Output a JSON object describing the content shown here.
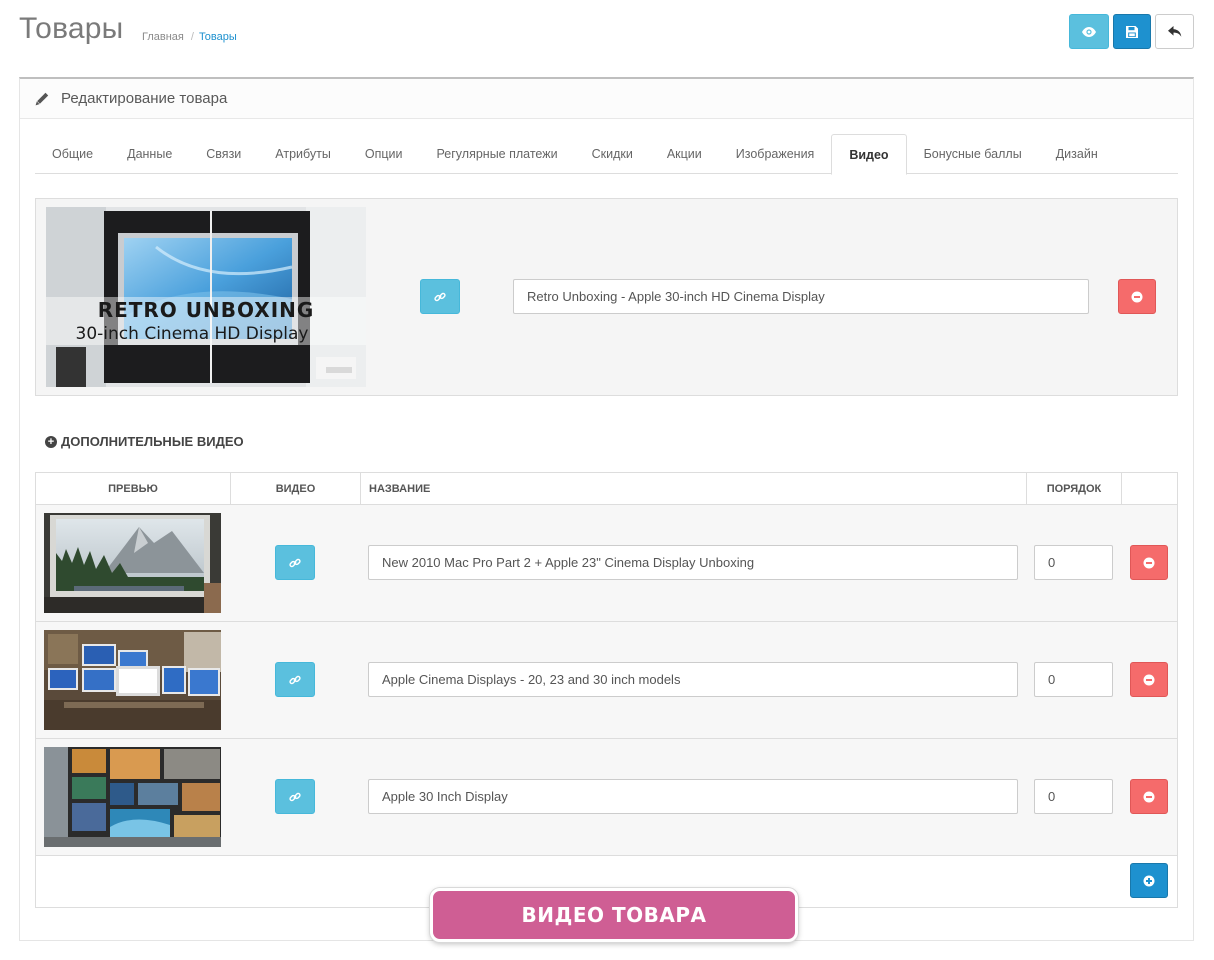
{
  "header": {
    "title": "Товары",
    "breadcrumb": {
      "home": "Главная",
      "separator": "/",
      "current": "Товары"
    },
    "buttons": {
      "view_icon": "eye-icon",
      "save_icon": "save-icon",
      "back_icon": "reply-icon"
    }
  },
  "panel": {
    "heading": "Редактирование товара",
    "heading_icon": "pencil-icon",
    "tabs": [
      "Общие",
      "Данные",
      "Связи",
      "Атрибуты",
      "Опции",
      "Регулярные платежи",
      "Скидки",
      "Акции",
      "Изображения",
      "Видео",
      "Бонусные баллы",
      "Дизайн"
    ],
    "active_tab": "Видео"
  },
  "main_video": {
    "thumbnail_caption_line1": "RETRO UNBOXING",
    "thumbnail_caption_line2": "30-inch Cinema HD Display",
    "title": "Retro Unboxing - Apple 30-inch HD Cinema Display"
  },
  "additional_videos": {
    "section_title": "ДОПОЛНИТЕЛЬНЫЕ ВИДЕО",
    "columns": {
      "preview": "ПРЕВЬЮ",
      "video": "ВИДЕО",
      "name": "НАЗВАНИЕ",
      "order": "ПОРЯДОК"
    },
    "rows": [
      {
        "name": "New 2010 Mac Pro Part 2 + Apple 23\" Cinema Display Unboxing",
        "order": "0"
      },
      {
        "name": "Apple Cinema Displays - 20, 23 and 30 inch models",
        "order": "0"
      },
      {
        "name": "Apple 30 Inch Display",
        "order": "0"
      }
    ]
  },
  "banner": {
    "text": "ВИДЕО ТОВАРА"
  },
  "colors": {
    "info": "#5bc0de",
    "primary": "#1e91cf",
    "danger": "#f56b6b",
    "banner": "#cf5e94"
  }
}
